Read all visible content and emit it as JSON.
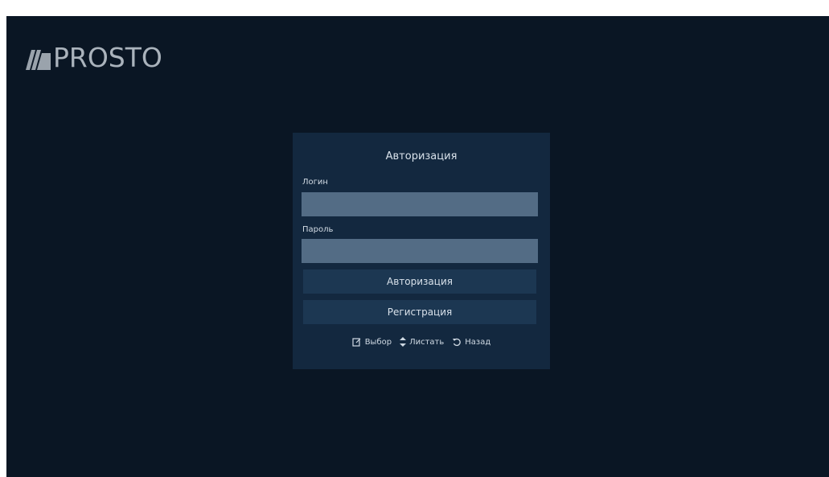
{
  "logo": {
    "text": "PROSTO"
  },
  "auth_panel": {
    "title": "Авторизация",
    "login_label": "Логин",
    "login_value": "",
    "password_label": "Пароль",
    "password_value": "",
    "auth_button_label": "Авторизация",
    "register_button_label": "Регистрация"
  },
  "hints": [
    {
      "icon": "select-icon",
      "label": "Выбор"
    },
    {
      "icon": "up-down-icon",
      "label": "Листать"
    },
    {
      "icon": "back-icon",
      "label": "Назад"
    }
  ],
  "colors": {
    "background": "#0a1624",
    "panel": "#13283f",
    "input": "#536c85",
    "button": "#1c3752"
  }
}
